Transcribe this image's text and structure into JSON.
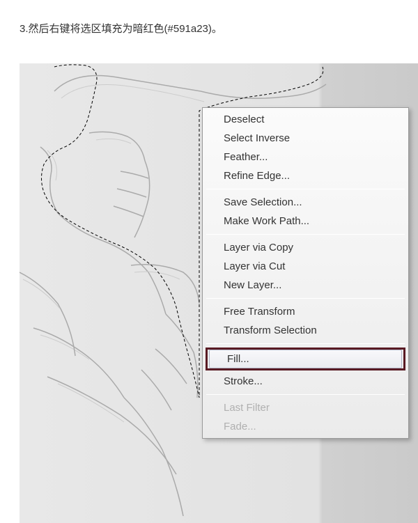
{
  "instruction": "3.然后右键将选区填充为暗红色(#591a23)。",
  "fill_color": "#591a23",
  "menu": {
    "deselect": "Deselect",
    "select_inverse": "Select Inverse",
    "feather": "Feather...",
    "refine_edge": "Refine Edge...",
    "save_selection": "Save Selection...",
    "make_work_path": "Make Work Path...",
    "layer_via_copy": "Layer via Copy",
    "layer_via_cut": "Layer via Cut",
    "new_layer": "New Layer...",
    "free_transform": "Free Transform",
    "transform_selection": "Transform Selection",
    "fill": "Fill...",
    "stroke": "Stroke...",
    "last_filter": "Last Filter",
    "fade": "Fade..."
  }
}
